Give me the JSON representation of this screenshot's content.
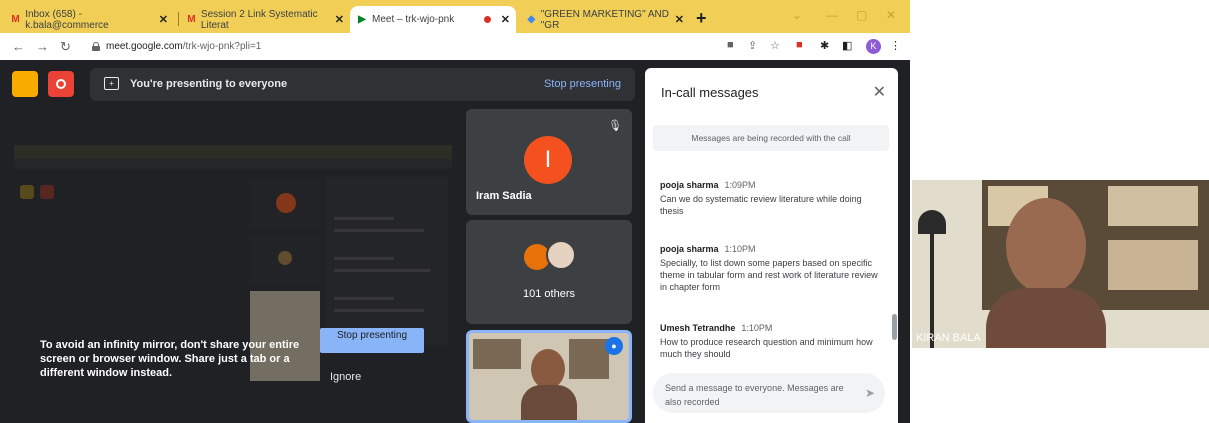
{
  "browser": {
    "tabs": [
      {
        "label": "Inbox (658) - k.bala@commerce",
        "favicon": "gmail-icon"
      },
      {
        "label": "Session 2 Link Systematic Literat",
        "favicon": "gmail-icon"
      },
      {
        "label": "Meet – trk-wjo-pnk",
        "favicon": "meet-icon"
      },
      {
        "label": "\"GREEN MARKETING\" AND \"GR",
        "favicon": "site-icon"
      }
    ],
    "active_tab": 2,
    "url_host": "meet.google.com",
    "url_path": "/trk-wjo-pnk?pli=1",
    "profile_initial": "K",
    "accent": "#f1cf57"
  },
  "presenting": {
    "message": "You're presenting to everyone",
    "stop_label": "Stop presenting"
  },
  "mirror_warning": {
    "text": "To avoid an infinity mirror, don't share your entire screen or browser window. Share just a tab or a different window instead.",
    "stop_button": "Stop presenting",
    "ignore_button": "Ignore"
  },
  "participants": {
    "tile1": {
      "name": "Iram Sadia",
      "initial": "I"
    },
    "tile2": {
      "count_label": "101 others"
    }
  },
  "chat": {
    "title": "In-call messages",
    "notice": "Messages are being recorded with the call",
    "messages": [
      {
        "sender": "pooja sharma",
        "time": "1:09PM",
        "text": "Can we do systematic review literature while doing thesis"
      },
      {
        "sender": "pooja sharma",
        "time": "1:10PM",
        "text": "Specially, to list down some papers based on specific theme in tabular form and rest work of literature review in chapter form"
      },
      {
        "sender": "Umesh Tetrandhe",
        "time": "1:10PM",
        "text": "How to produce research question and minimum how much they should"
      }
    ],
    "input_placeholder": "Send a message to everyone. Messages are also recorded"
  },
  "camera": {
    "name": "KIRAN BALA"
  }
}
